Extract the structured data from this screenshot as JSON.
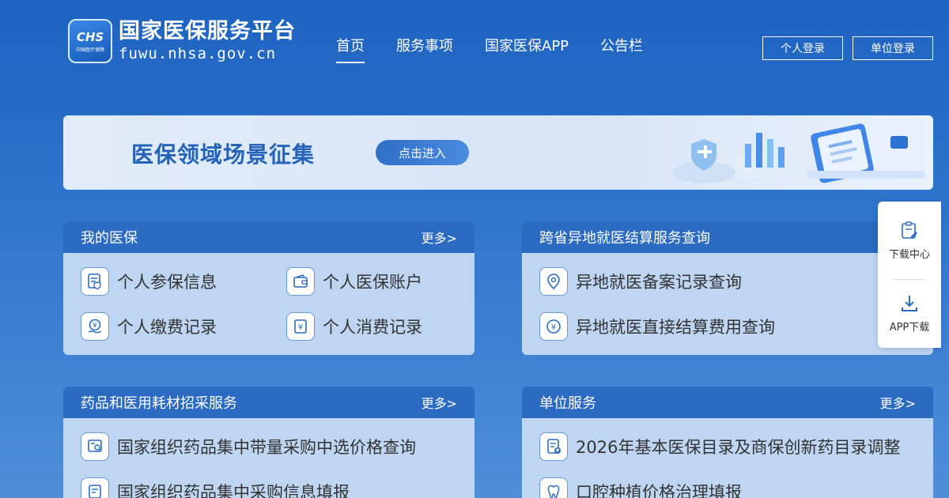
{
  "logo": {
    "badge_text": "CHS",
    "badge_sub": "中国医疗保障",
    "title": "国家医保服务平台",
    "domain": "fuwu.nhsa.gov.cn"
  },
  "nav": {
    "items": [
      {
        "label": "首页",
        "active": true
      },
      {
        "label": "服务事项",
        "active": false
      },
      {
        "label": "国家医保APP",
        "active": false
      },
      {
        "label": "公告栏",
        "active": false
      }
    ]
  },
  "login": {
    "personal": "个人登录",
    "unit": "单位登录"
  },
  "banner": {
    "title": "医保领域场景征集",
    "button": "点击进入"
  },
  "cards": [
    {
      "title": "我的医保",
      "more": "更多>",
      "items": [
        "个人参保信息",
        "个人医保账户",
        "个人缴费记录",
        "个人消费记录"
      ]
    },
    {
      "title": "跨省异地就医结算服务查询",
      "items": [
        "异地就医备案记录查询",
        "异地就医直接结算费用查询"
      ]
    },
    {
      "title": "药品和医用耗材招采服务",
      "more": "更多>",
      "items": [
        "国家组织药品集中带量采购中选价格查询",
        "国家组织药品集中采购信息填报"
      ]
    },
    {
      "title": "单位服务",
      "more": "更多>",
      "items": [
        "2026年基本医保目录及商保创新药目录调整",
        "口腔种植价格治理填报"
      ]
    }
  ],
  "side": {
    "download_center": "下载中心",
    "app_download": "APP下载"
  }
}
